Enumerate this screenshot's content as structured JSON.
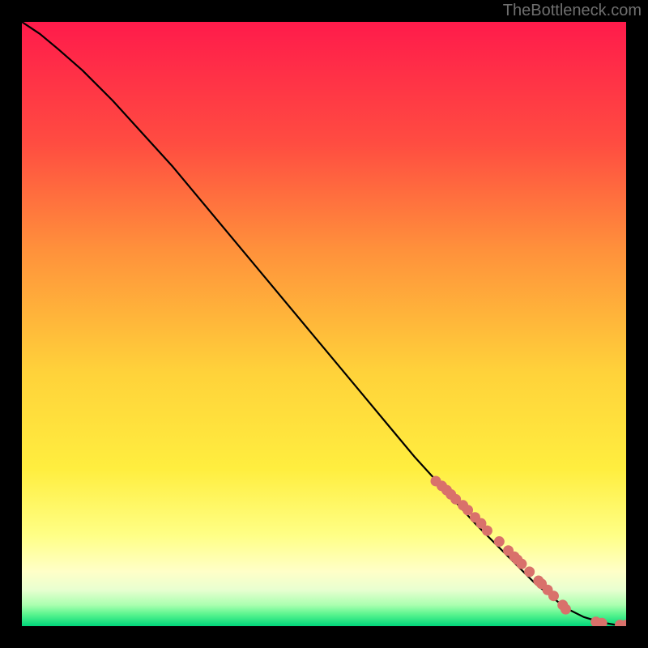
{
  "watermark": "TheBottleneck.com",
  "colors": {
    "page_bg": "#000000",
    "watermark": "#6f6f6f",
    "line": "#000000",
    "point_fill": "#d9716b",
    "gradient": {
      "top": "#ff1b4b",
      "q1": "#ff7a3a",
      "mid": "#ffe93a",
      "q3": "#ffff9a",
      "green_hi": "#8cff7a",
      "green_lo": "#00d67a"
    }
  },
  "chart_data": {
    "type": "line",
    "title": "",
    "xlabel": "",
    "ylabel": "",
    "xlim": [
      0,
      100
    ],
    "ylim": [
      0,
      100
    ],
    "series": [
      {
        "name": "curve",
        "kind": "line",
        "x": [
          0,
          3,
          6,
          10,
          15,
          20,
          25,
          30,
          35,
          40,
          45,
          50,
          55,
          60,
          65,
          70,
          75,
          80,
          85,
          90,
          93,
          96,
          98,
          100
        ],
        "y": [
          100,
          98,
          95.5,
          92,
          87,
          81.5,
          76,
          70,
          64,
          58,
          52,
          46,
          40,
          34,
          28,
          22.5,
          17,
          12,
          7,
          3,
          1.5,
          0.6,
          0.25,
          0.15
        ]
      },
      {
        "name": "points",
        "kind": "scatter",
        "x": [
          68.5,
          69.5,
          70.3,
          71.0,
          71.8,
          73.0,
          73.8,
          75.0,
          76.0,
          77.0,
          79.0,
          80.5,
          81.5,
          82.0,
          82.7,
          84.0,
          85.5,
          86.0,
          87.0,
          88.0,
          89.5,
          90.0,
          95.0,
          96.0,
          99.0,
          100.0
        ],
        "y": [
          24.0,
          23.2,
          22.5,
          21.8,
          21.0,
          20.0,
          19.2,
          18.0,
          17.0,
          15.8,
          14.0,
          12.5,
          11.5,
          11.0,
          10.3,
          9.0,
          7.5,
          7.0,
          6.0,
          5.0,
          3.5,
          2.8,
          0.7,
          0.5,
          0.2,
          0.2
        ]
      }
    ]
  }
}
